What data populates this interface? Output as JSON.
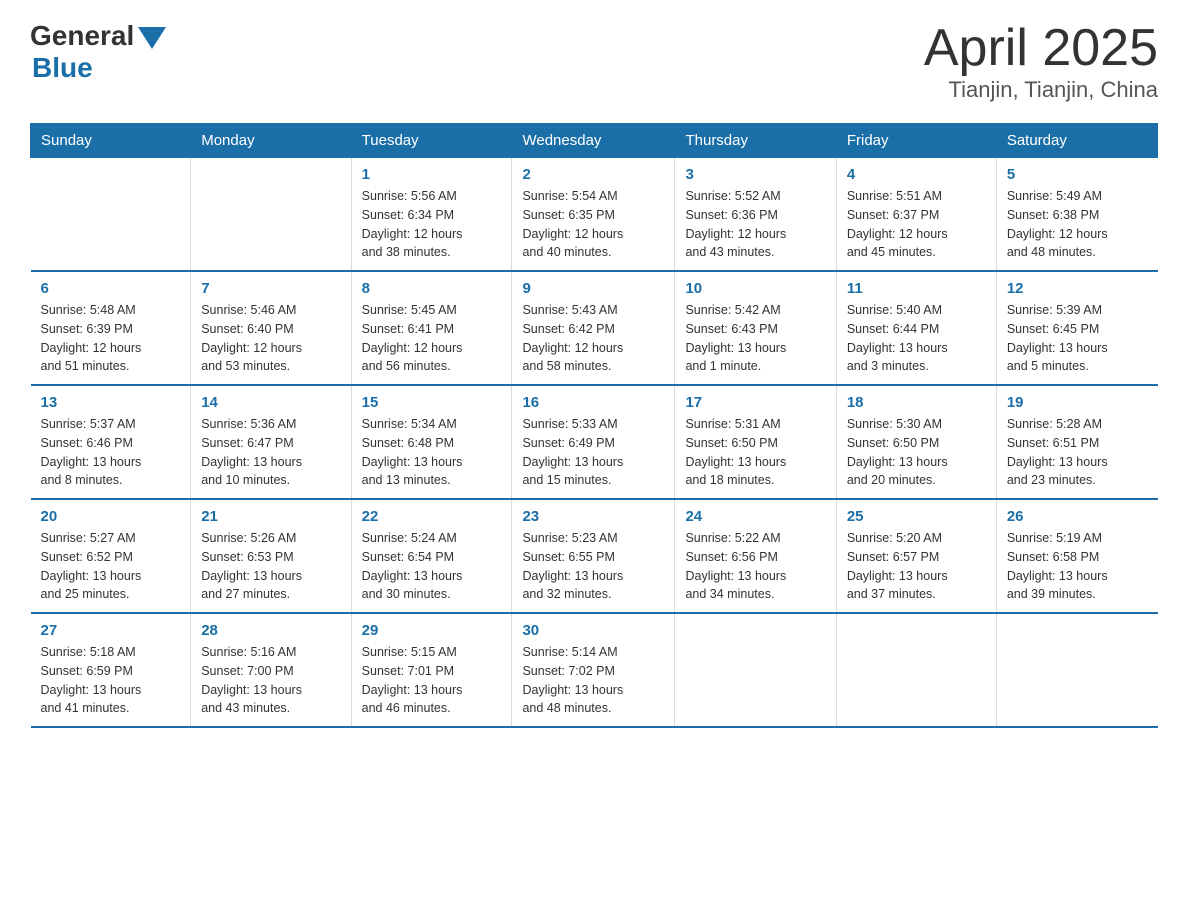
{
  "logo": {
    "general": "General",
    "blue": "Blue"
  },
  "title": {
    "month": "April 2025",
    "location": "Tianjin, Tianjin, China"
  },
  "days_of_week": [
    "Sunday",
    "Monday",
    "Tuesday",
    "Wednesday",
    "Thursday",
    "Friday",
    "Saturday"
  ],
  "weeks": [
    [
      {
        "day": "",
        "info": ""
      },
      {
        "day": "",
        "info": ""
      },
      {
        "day": "1",
        "info": "Sunrise: 5:56 AM\nSunset: 6:34 PM\nDaylight: 12 hours\nand 38 minutes."
      },
      {
        "day": "2",
        "info": "Sunrise: 5:54 AM\nSunset: 6:35 PM\nDaylight: 12 hours\nand 40 minutes."
      },
      {
        "day": "3",
        "info": "Sunrise: 5:52 AM\nSunset: 6:36 PM\nDaylight: 12 hours\nand 43 minutes."
      },
      {
        "day": "4",
        "info": "Sunrise: 5:51 AM\nSunset: 6:37 PM\nDaylight: 12 hours\nand 45 minutes."
      },
      {
        "day": "5",
        "info": "Sunrise: 5:49 AM\nSunset: 6:38 PM\nDaylight: 12 hours\nand 48 minutes."
      }
    ],
    [
      {
        "day": "6",
        "info": "Sunrise: 5:48 AM\nSunset: 6:39 PM\nDaylight: 12 hours\nand 51 minutes."
      },
      {
        "day": "7",
        "info": "Sunrise: 5:46 AM\nSunset: 6:40 PM\nDaylight: 12 hours\nand 53 minutes."
      },
      {
        "day": "8",
        "info": "Sunrise: 5:45 AM\nSunset: 6:41 PM\nDaylight: 12 hours\nand 56 minutes."
      },
      {
        "day": "9",
        "info": "Sunrise: 5:43 AM\nSunset: 6:42 PM\nDaylight: 12 hours\nand 58 minutes."
      },
      {
        "day": "10",
        "info": "Sunrise: 5:42 AM\nSunset: 6:43 PM\nDaylight: 13 hours\nand 1 minute."
      },
      {
        "day": "11",
        "info": "Sunrise: 5:40 AM\nSunset: 6:44 PM\nDaylight: 13 hours\nand 3 minutes."
      },
      {
        "day": "12",
        "info": "Sunrise: 5:39 AM\nSunset: 6:45 PM\nDaylight: 13 hours\nand 5 minutes."
      }
    ],
    [
      {
        "day": "13",
        "info": "Sunrise: 5:37 AM\nSunset: 6:46 PM\nDaylight: 13 hours\nand 8 minutes."
      },
      {
        "day": "14",
        "info": "Sunrise: 5:36 AM\nSunset: 6:47 PM\nDaylight: 13 hours\nand 10 minutes."
      },
      {
        "day": "15",
        "info": "Sunrise: 5:34 AM\nSunset: 6:48 PM\nDaylight: 13 hours\nand 13 minutes."
      },
      {
        "day": "16",
        "info": "Sunrise: 5:33 AM\nSunset: 6:49 PM\nDaylight: 13 hours\nand 15 minutes."
      },
      {
        "day": "17",
        "info": "Sunrise: 5:31 AM\nSunset: 6:50 PM\nDaylight: 13 hours\nand 18 minutes."
      },
      {
        "day": "18",
        "info": "Sunrise: 5:30 AM\nSunset: 6:50 PM\nDaylight: 13 hours\nand 20 minutes."
      },
      {
        "day": "19",
        "info": "Sunrise: 5:28 AM\nSunset: 6:51 PM\nDaylight: 13 hours\nand 23 minutes."
      }
    ],
    [
      {
        "day": "20",
        "info": "Sunrise: 5:27 AM\nSunset: 6:52 PM\nDaylight: 13 hours\nand 25 minutes."
      },
      {
        "day": "21",
        "info": "Sunrise: 5:26 AM\nSunset: 6:53 PM\nDaylight: 13 hours\nand 27 minutes."
      },
      {
        "day": "22",
        "info": "Sunrise: 5:24 AM\nSunset: 6:54 PM\nDaylight: 13 hours\nand 30 minutes."
      },
      {
        "day": "23",
        "info": "Sunrise: 5:23 AM\nSunset: 6:55 PM\nDaylight: 13 hours\nand 32 minutes."
      },
      {
        "day": "24",
        "info": "Sunrise: 5:22 AM\nSunset: 6:56 PM\nDaylight: 13 hours\nand 34 minutes."
      },
      {
        "day": "25",
        "info": "Sunrise: 5:20 AM\nSunset: 6:57 PM\nDaylight: 13 hours\nand 37 minutes."
      },
      {
        "day": "26",
        "info": "Sunrise: 5:19 AM\nSunset: 6:58 PM\nDaylight: 13 hours\nand 39 minutes."
      }
    ],
    [
      {
        "day": "27",
        "info": "Sunrise: 5:18 AM\nSunset: 6:59 PM\nDaylight: 13 hours\nand 41 minutes."
      },
      {
        "day": "28",
        "info": "Sunrise: 5:16 AM\nSunset: 7:00 PM\nDaylight: 13 hours\nand 43 minutes."
      },
      {
        "day": "29",
        "info": "Sunrise: 5:15 AM\nSunset: 7:01 PM\nDaylight: 13 hours\nand 46 minutes."
      },
      {
        "day": "30",
        "info": "Sunrise: 5:14 AM\nSunset: 7:02 PM\nDaylight: 13 hours\nand 48 minutes."
      },
      {
        "day": "",
        "info": ""
      },
      {
        "day": "",
        "info": ""
      },
      {
        "day": "",
        "info": ""
      }
    ]
  ]
}
